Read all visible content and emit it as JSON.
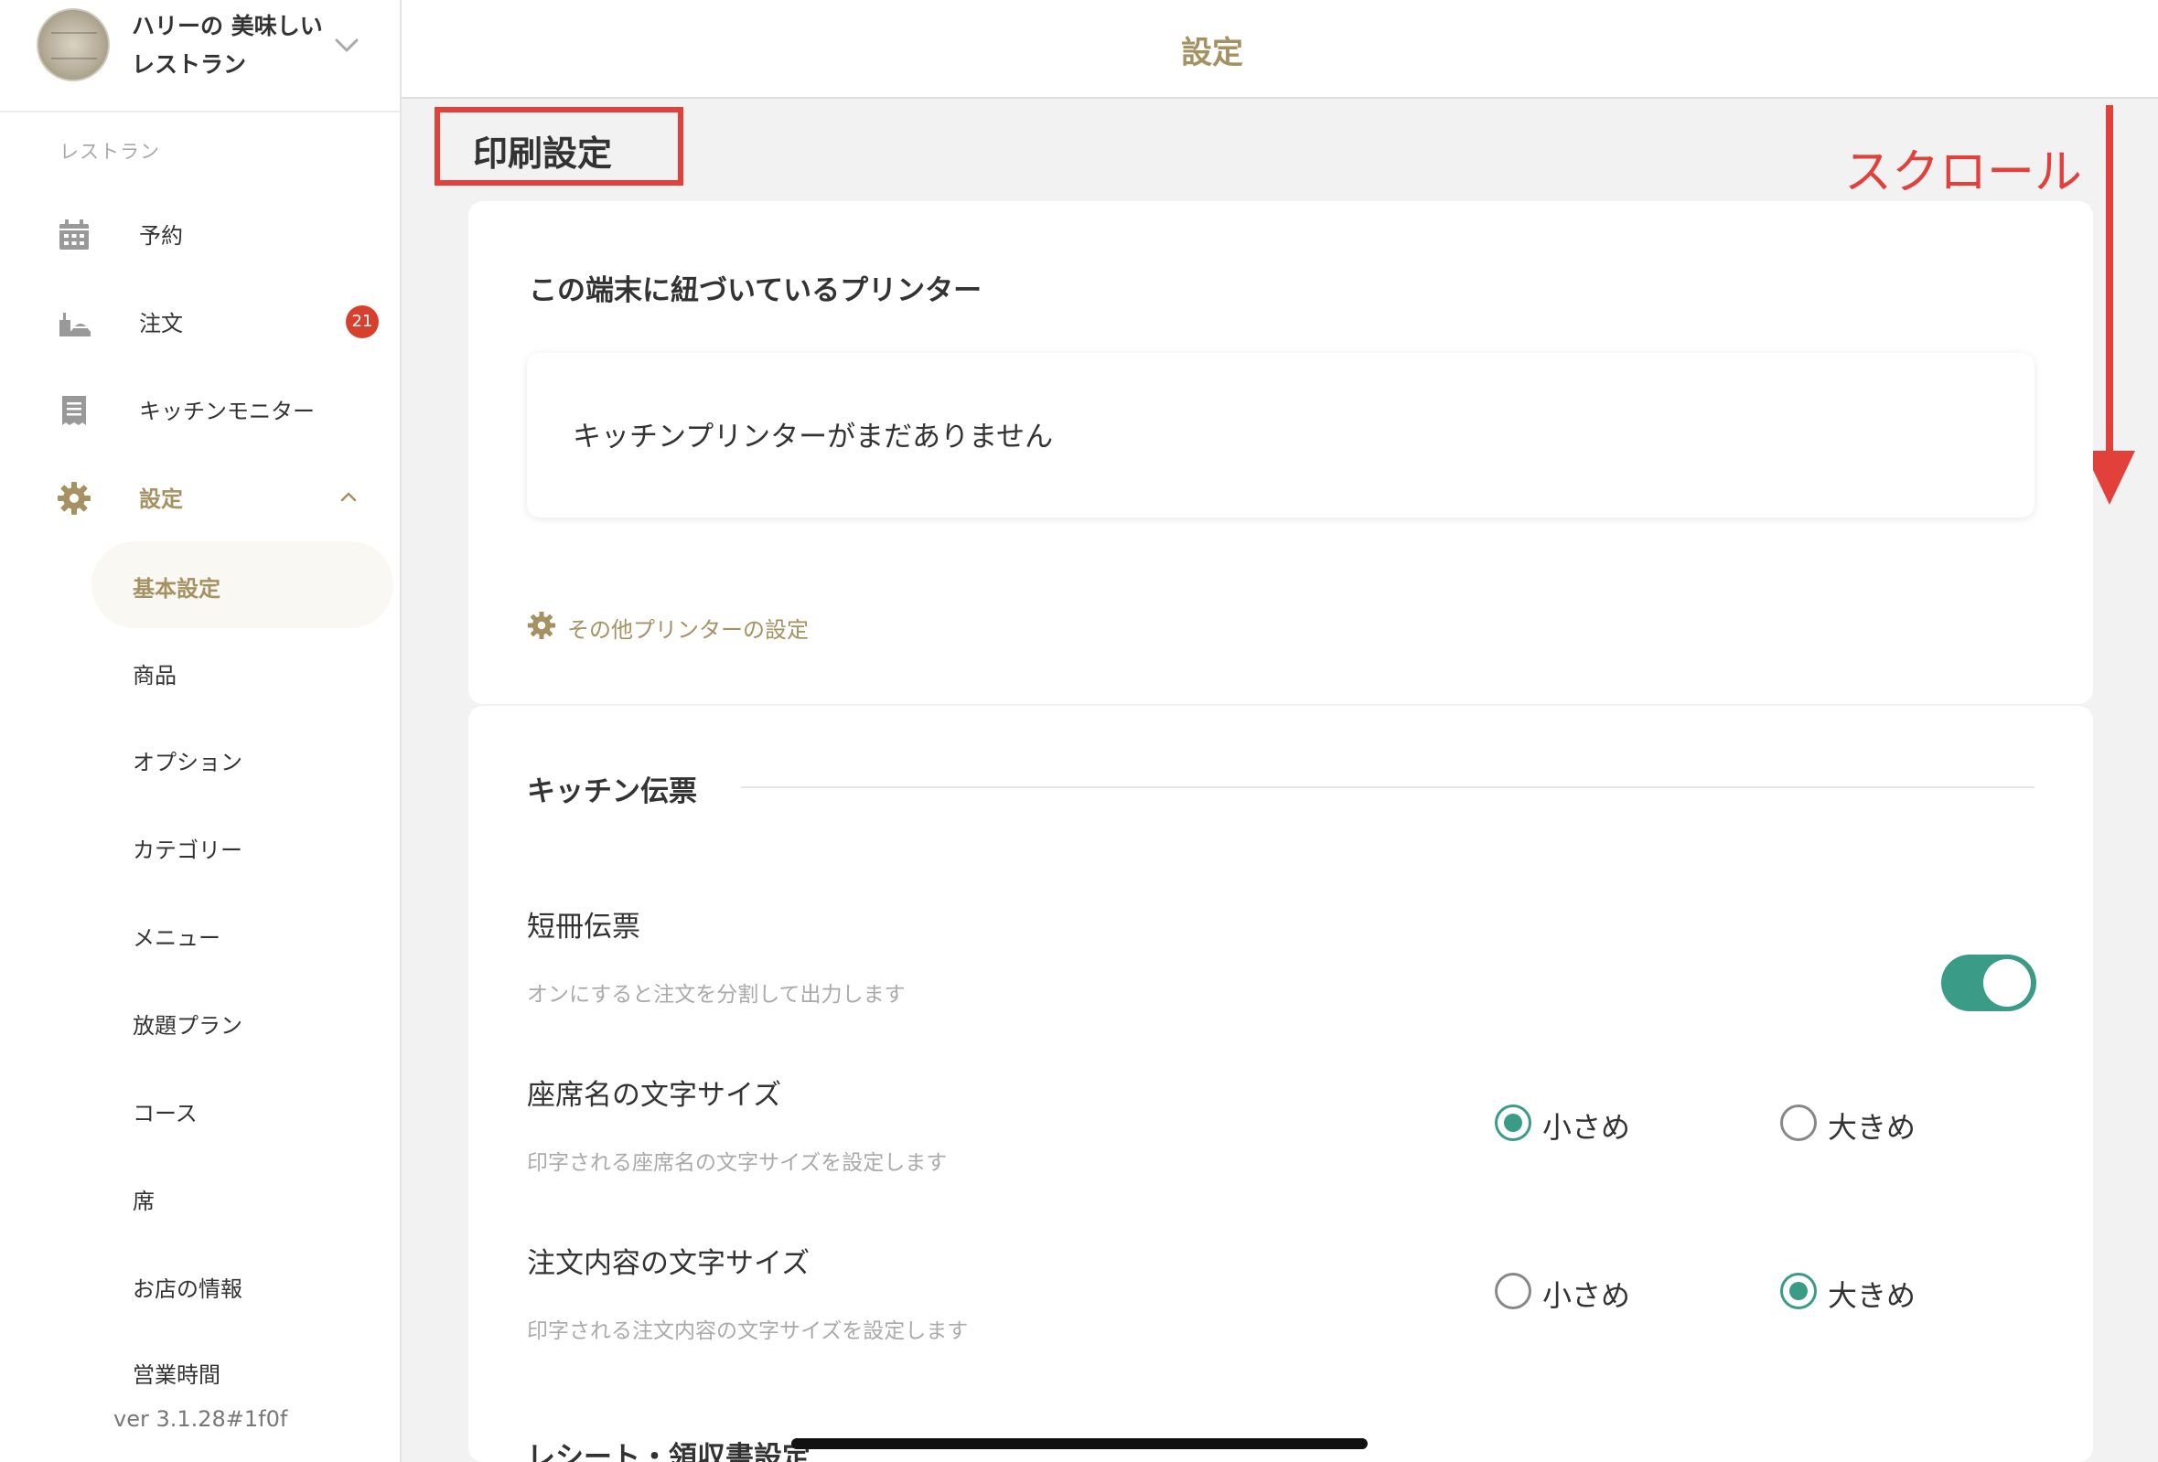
{
  "sidebar": {
    "restaurant_name": "ハリーの 美味しいレストラン",
    "section_label": "レストラン",
    "nav": [
      {
        "label": "予約",
        "icon": "calendar-icon"
      },
      {
        "label": "注文",
        "icon": "order-tray-icon",
        "badge": "21"
      },
      {
        "label": "キッチンモニター",
        "icon": "receipt-icon"
      },
      {
        "label": "設定",
        "icon": "gear-icon",
        "active": true
      }
    ],
    "sub_items": [
      "基本設定",
      "商品",
      "オプション",
      "カテゴリー",
      "メニュー",
      "放題プラン",
      "コース",
      "席",
      "お店の情報",
      "営業時間"
    ],
    "selected_sub_item": "基本設定",
    "version": "ver 3.1.28#1f0f"
  },
  "header": {
    "title": "設定"
  },
  "main": {
    "section_title": "印刷設定",
    "annotation_scroll": "スクロール",
    "printer_card": {
      "title": "この端末に紐づいているプリンター",
      "empty_message": "キッチンプリンターがまだありません",
      "other_printer_link": "その他プリンターの設定"
    },
    "kitchen_card": {
      "title": "キッチン伝票",
      "settings": {
        "tanzaku": {
          "label": "短冊伝票",
          "description": "オンにすると注文を分割して出力します",
          "enabled": true
        },
        "seat_font": {
          "label": "座席名の文字サイズ",
          "description": "印字される座席名の文字サイズを設定します",
          "options": [
            "小さめ",
            "大きめ"
          ],
          "selected": "小さめ"
        },
        "order_font": {
          "label": "注文内容の文字サイズ",
          "description": "印字される注文内容の文字サイズを設定します",
          "options": [
            "小さめ",
            "大きめ"
          ],
          "selected": "大きめ"
        }
      },
      "next_section_title": "レシート・領収書設定"
    }
  },
  "colors": {
    "accent_gold": "#a59262",
    "toggle_green": "#3a9c86",
    "badge_red": "#d8402e",
    "annotation_red": "#e2403b"
  }
}
